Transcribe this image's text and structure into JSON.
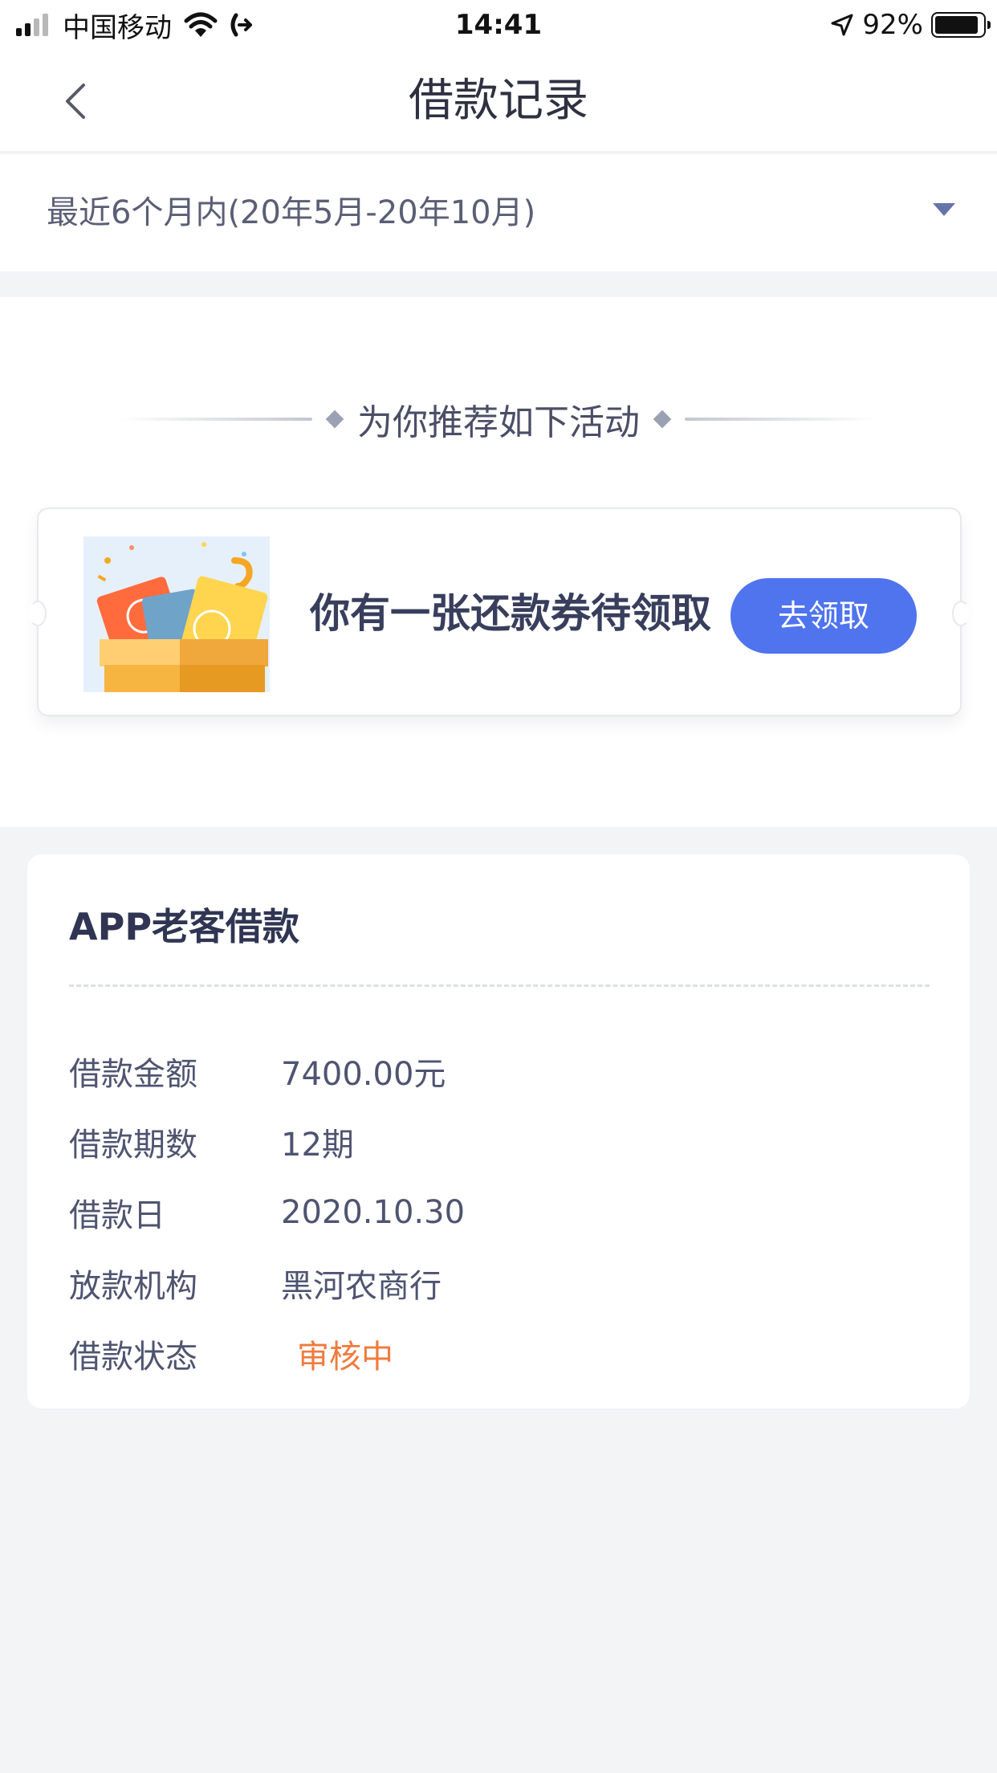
{
  "status_bar": {
    "carrier": "中国移动",
    "time": "14:41",
    "battery": "92%",
    "battery_level": 0.92,
    "icons": [
      "signal-icon",
      "wifi-icon",
      "call-forward-icon",
      "location-arrow-icon",
      "battery-icon"
    ]
  },
  "nav": {
    "title": "借款记录",
    "back_icon": "chevron-left-icon"
  },
  "filter": {
    "label": "最近6个月内(20年5月-20年10月)",
    "caret_icon": "caret-down-icon"
  },
  "recommend": {
    "heading": "为你推荐如下活动",
    "coupon_text": "你有一张还款券待领取",
    "claim_button": "去领取",
    "coupon_image_icon": "gift-box-coupon-icon"
  },
  "loan": {
    "title": "APP老客借款",
    "rows": [
      {
        "label": "借款金额",
        "value": "7400.00元"
      },
      {
        "label": "借款期数",
        "value": "12期"
      },
      {
        "label": "借款日",
        "value": "2020.10.30"
      },
      {
        "label": "放款机构",
        "value": "黑河农商行"
      },
      {
        "label": "借款状态",
        "value": "审核中"
      }
    ]
  },
  "colors": {
    "accent_button": "#4f74ee",
    "status_pending": "#ef7b3e",
    "page_background": "#f3f4f6"
  }
}
